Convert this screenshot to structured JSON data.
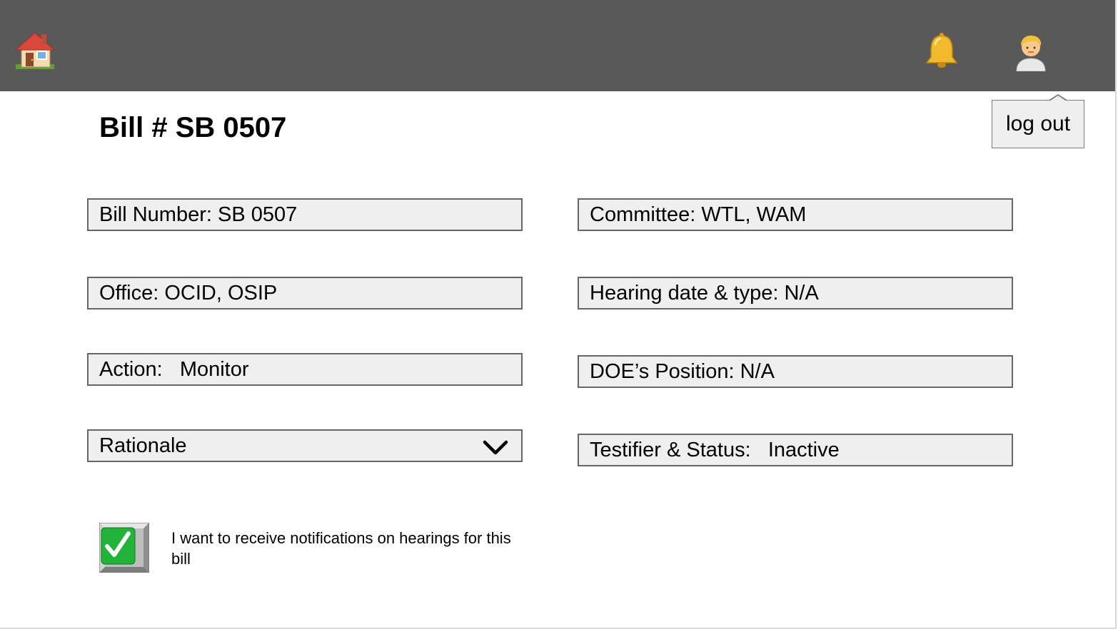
{
  "header": {
    "home_icon": "home-icon",
    "bell_icon": "bell-icon",
    "user_icon": "user-avatar-icon"
  },
  "user_menu": {
    "logout_label": "log out"
  },
  "page": {
    "title": "Bill # SB 0507"
  },
  "fields": {
    "bill_number": "Bill Number: SB 0507",
    "office": "Office: OCID, OSIP",
    "action": "Action:   Monitor",
    "rationale": "Rationale",
    "committee": "Committee: WTL, WAM",
    "hearing": "Hearing date & type: N/A",
    "doe_position": "DOE’s Position: N/A",
    "testifier_status": "Testifier & Status:   Inactive"
  },
  "notifications": {
    "checked": true,
    "label": "I want to receive notifications on hearings for this bill"
  },
  "colors": {
    "topbar": "#595959",
    "field_bg": "#efefef",
    "field_border": "#666666",
    "checkbox_green": "#21b33a"
  }
}
